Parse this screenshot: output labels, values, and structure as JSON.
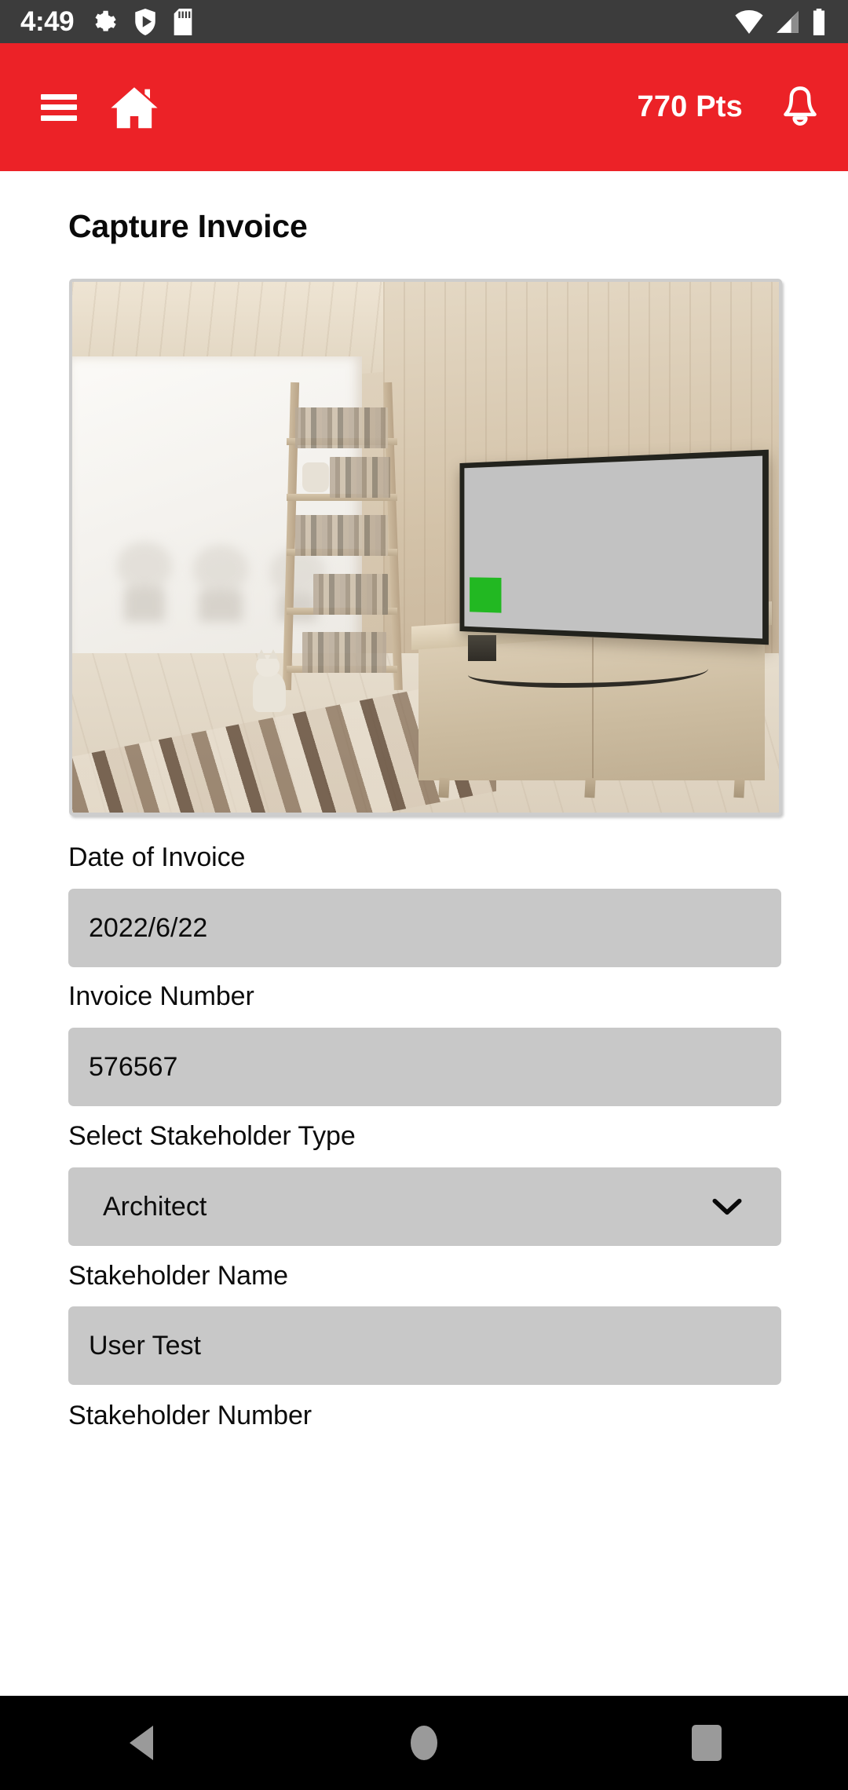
{
  "status_bar": {
    "time": "4:49",
    "left_icons": [
      "gear-icon",
      "shield-play-icon",
      "sd-card-icon"
    ],
    "right_icons": [
      "wifi-icon",
      "cellular-signal-icon",
      "battery-icon"
    ],
    "background": "#3c3c3c"
  },
  "app_bar": {
    "background": "#ec2227",
    "menu_icon": "hamburger-menu-icon",
    "home_icon": "home-icon",
    "points_label": "770 Pts",
    "notification_icon": "bell-icon"
  },
  "page": {
    "title": "Capture Invoice"
  },
  "preview": {
    "alt_description": "Captured invoice photo preview",
    "accent_green": "#22b822"
  },
  "form": {
    "fields": [
      {
        "label": "Date of Invoice",
        "value": "2022/6/22",
        "type": "text",
        "placeholder": "Date of Invoice"
      },
      {
        "label": "Invoice Number",
        "value": "576567",
        "type": "text",
        "placeholder": "Invoice Number"
      },
      {
        "label": "Select Stakeholder Type",
        "value": "Architect",
        "type": "select",
        "placeholder": "Select Stakeholder Type",
        "options": [
          "Architect"
        ],
        "chevron_icon": "chevron-down-icon"
      },
      {
        "label": "Stakeholder Name",
        "value": "User Test",
        "type": "text",
        "placeholder": "Stakeholder Name"
      },
      {
        "label": "Stakeholder Number",
        "value": "",
        "type": "text",
        "placeholder": "Stakeholder Number"
      }
    ],
    "field_background": "#c8c8c8"
  },
  "nav_bar": {
    "background": "#000000",
    "buttons": [
      "back-button",
      "home-button",
      "recent-apps-button"
    ],
    "icon_color": "#9a9a9a"
  }
}
